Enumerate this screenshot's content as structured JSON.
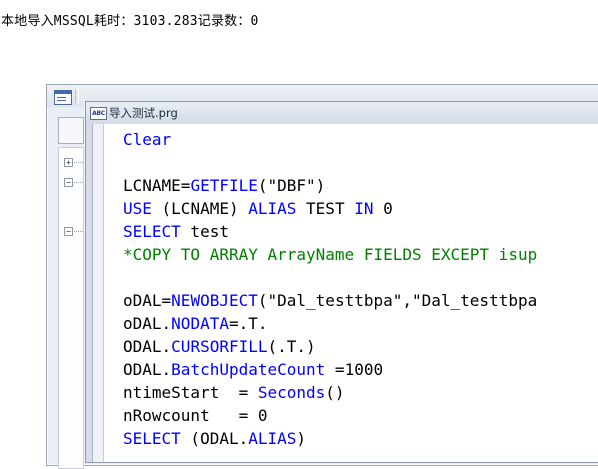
{
  "status_line": "本地导入MSSQL耗时：3103.283记录数：0",
  "outer_window": {
    "title_icon": "form-window-icon",
    "tree_toggles": [
      "+",
      "−",
      "−"
    ]
  },
  "editor": {
    "title_icon": "abc-file-icon",
    "title_icon_text": "ABC",
    "title": "导入测试.prg",
    "lines": [
      [
        {
          "t": "Clear",
          "c": "kw"
        }
      ],
      [],
      [
        {
          "t": "LCNAME=",
          "c": "p"
        },
        {
          "t": "GETFILE",
          "c": "kw"
        },
        {
          "t": "(\"DBF\")",
          "c": "p"
        }
      ],
      [
        {
          "t": "USE",
          "c": "kw"
        },
        {
          "t": " (LCNAME) ",
          "c": "p"
        },
        {
          "t": "ALIAS",
          "c": "kw"
        },
        {
          "t": " TEST ",
          "c": "p"
        },
        {
          "t": "IN",
          "c": "kw"
        },
        {
          "t": " 0",
          "c": "p"
        }
      ],
      [
        {
          "t": "SELECT",
          "c": "kw"
        },
        {
          "t": " test",
          "c": "p"
        }
      ],
      [
        {
          "t": "*COPY TO ARRAY ArrayName FIELDS EXCEPT isup",
          "c": "cm"
        }
      ],
      [],
      [
        {
          "t": "oDAL=",
          "c": "p"
        },
        {
          "t": "NEWOBJECT",
          "c": "kw"
        },
        {
          "t": "(\"Dal_testtbpa\",\"Dal_testtbpa",
          "c": "p"
        }
      ],
      [
        {
          "t": "oDAL.",
          "c": "p"
        },
        {
          "t": "NODATA",
          "c": "kw"
        },
        {
          "t": "=.T.",
          "c": "p"
        }
      ],
      [
        {
          "t": "ODAL.",
          "c": "p"
        },
        {
          "t": "CURSORFILL",
          "c": "kw"
        },
        {
          "t": "(.T.)",
          "c": "p"
        }
      ],
      [
        {
          "t": "ODAL.",
          "c": "p"
        },
        {
          "t": "BatchUpdateCount",
          "c": "kw"
        },
        {
          "t": " =1000",
          "c": "p"
        }
      ],
      [
        {
          "t": "ntimeStart  = ",
          "c": "p"
        },
        {
          "t": "Seconds",
          "c": "kw"
        },
        {
          "t": "()",
          "c": "p"
        }
      ],
      [
        {
          "t": "nRowcount   = 0",
          "c": "p"
        }
      ],
      [
        {
          "t": "SELECT",
          "c": "kw"
        },
        {
          "t": " (ODAL.",
          "c": "p"
        },
        {
          "t": "ALIAS",
          "c": "kw"
        },
        {
          "t": ")",
          "c": "p"
        }
      ]
    ]
  }
}
